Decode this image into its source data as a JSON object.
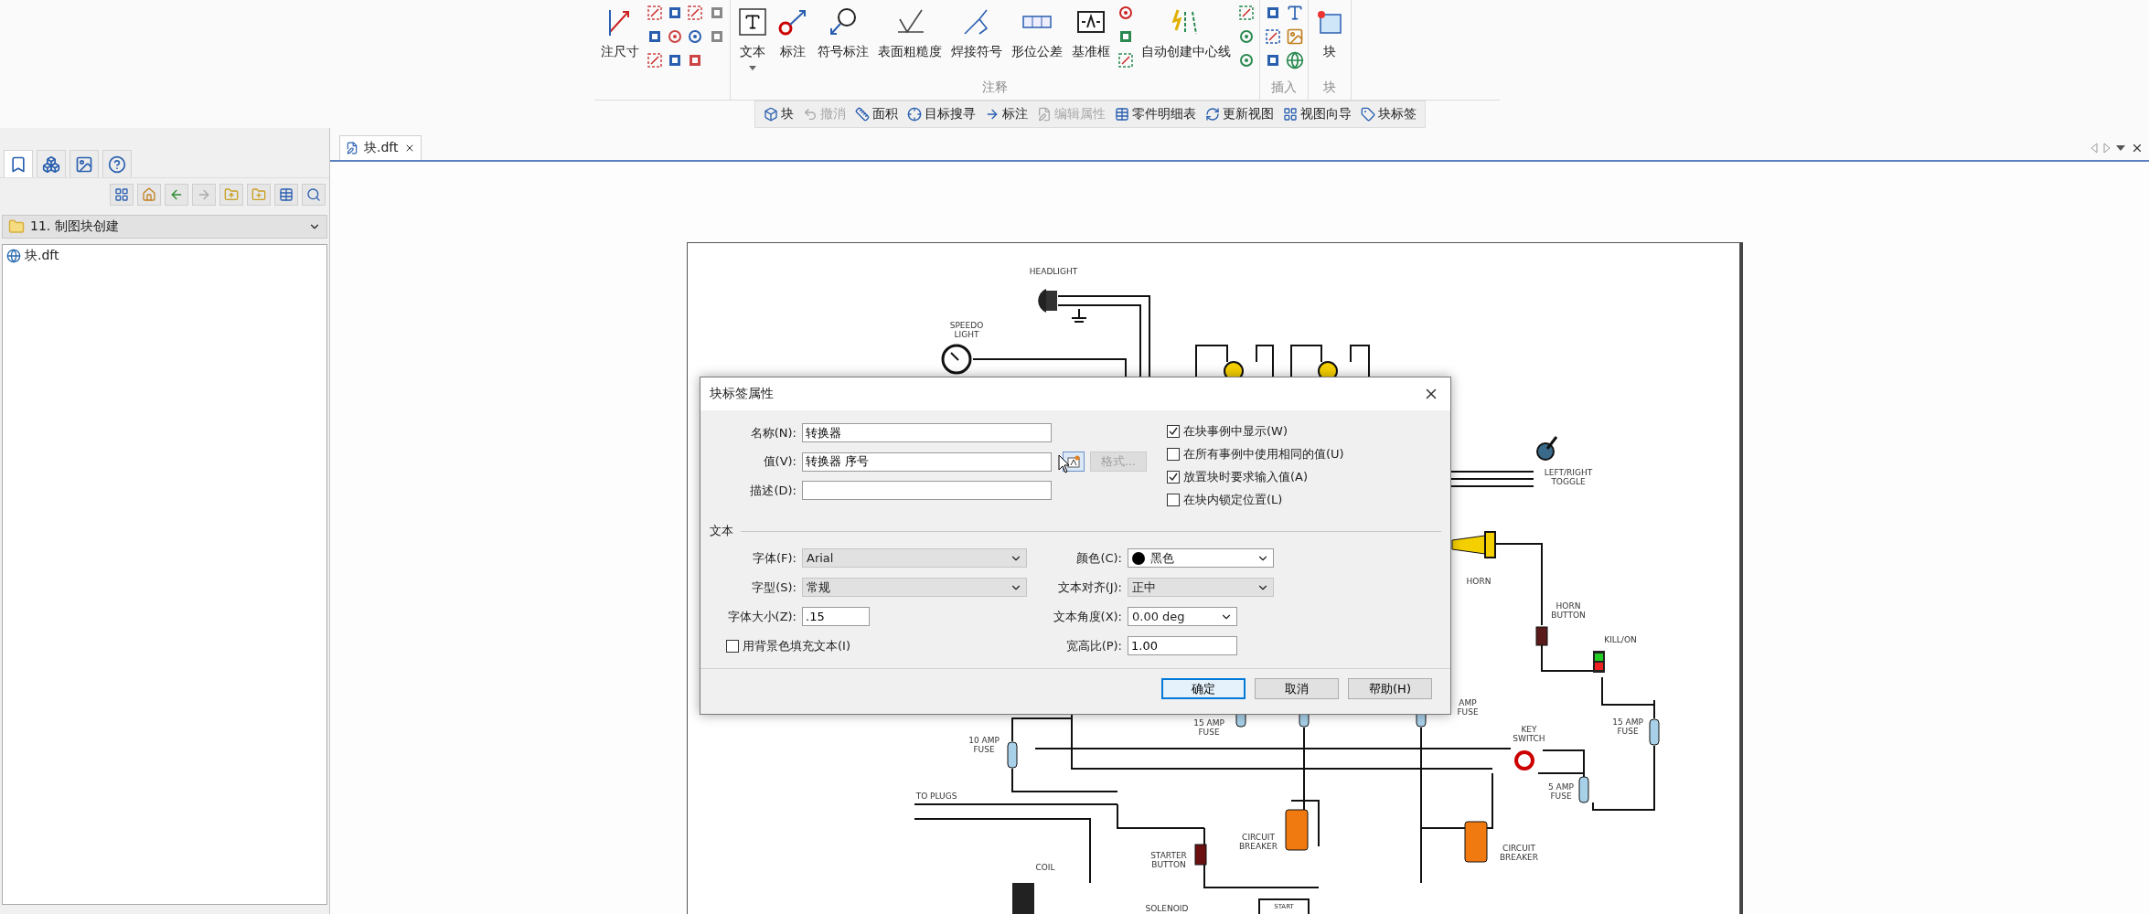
{
  "ribbon": {
    "partial_button": {
      "label": "注尺寸"
    },
    "annotation_group": {
      "label": "注释",
      "buttons": [
        {
          "label": "文本",
          "has_menu": true
        },
        {
          "label": "标注",
          "has_menu": false
        },
        {
          "label": "符号标注",
          "has_menu": false
        },
        {
          "label": "表面粗糙度",
          "has_menu": false
        },
        {
          "label": "焊接符号",
          "has_menu": false
        },
        {
          "label": "形位公差",
          "has_menu": false
        },
        {
          "label": "基准框",
          "has_menu": false
        },
        {
          "label": "自动创建中心线",
          "has_menu": false
        }
      ]
    },
    "insert_group": {
      "label": "插入"
    },
    "block_group": {
      "label": "块",
      "buttons": [
        {
          "label": "块"
        }
      ]
    }
  },
  "quick_bar": [
    {
      "label": "块",
      "disabled": false
    },
    {
      "label": "撤消",
      "disabled": true
    },
    {
      "label": "面积",
      "disabled": false
    },
    {
      "label": "目标搜寻",
      "disabled": false
    },
    {
      "label": "标注",
      "disabled": false
    },
    {
      "label": "编辑属性",
      "disabled": true
    },
    {
      "label": "零件明细表",
      "disabled": false
    },
    {
      "label": "更新视图",
      "disabled": false
    },
    {
      "label": "视图向导",
      "disabled": false
    },
    {
      "label": "块标签",
      "disabled": false
    }
  ],
  "left_panel": {
    "tabs": [
      {
        "selected": true
      },
      {
        "selected": false
      },
      {
        "selected": false
      },
      {
        "selected": false
      }
    ],
    "folder": "11. 制图块创建",
    "files": [
      "块.dft"
    ]
  },
  "document_tab": {
    "label": "块.dft"
  },
  "schematic": {
    "labels": [
      {
        "lines": [
          "HEADLIGHT"
        ]
      },
      {
        "lines": [
          "SPEEDO",
          "LIGHT"
        ]
      },
      {
        "lines": [
          "LEFT/RIGHT",
          "TOGGLE"
        ]
      },
      {
        "lines": [
          "HORN"
        ]
      },
      {
        "lines": [
          "HORN",
          "BUTTON"
        ]
      },
      {
        "lines": [
          "KILL/ON"
        ]
      },
      {
        "lines": [
          "AMP",
          "FUSE"
        ]
      },
      {
        "lines": [
          "10 AMP",
          "FUSE"
        ]
      },
      {
        "lines": [
          "15 AMP",
          "FUSE"
        ]
      },
      {
        "lines": [
          "KEY",
          "SWITCH"
        ]
      },
      {
        "lines": [
          "15 AMP",
          "FUSE"
        ]
      },
      {
        "lines": [
          "5 AMP",
          "FUSE"
        ]
      },
      {
        "lines": [
          "TO PLUGS"
        ]
      },
      {
        "lines": [
          "COIL"
        ]
      },
      {
        "lines": [
          "STARTER",
          "BUTTON"
        ]
      },
      {
        "lines": [
          "CIRCUIT",
          "BREAKER"
        ]
      },
      {
        "lines": [
          "CIRCUIT",
          "BREAKER"
        ]
      },
      {
        "lines": [
          "SOLENOID"
        ]
      },
      {
        "lines": [
          "START"
        ]
      }
    ]
  },
  "dialog": {
    "title": "块标签属性",
    "fields": [
      {
        "label": "名称(N):",
        "value": "转换器"
      },
      {
        "label": "值(V):",
        "value": "转换器 序号"
      },
      {
        "label": "描述(D):"
      }
    ],
    "format_button": {
      "label": "格式...",
      "disabled": true
    },
    "options": [
      {
        "label": "在块事例中显示(W)",
        "checked": true
      },
      {
        "label": "在所有事例中使用相同的值(U)",
        "checked": false
      },
      {
        "label": "放置块时要求输入值(A)",
        "checked": true
      },
      {
        "label": "在块内锁定位置(L)",
        "checked": false
      }
    ],
    "section": "文本",
    "text_settings_left": [
      {
        "label": "字体(F):",
        "value": "Arial",
        "kind": "select"
      },
      {
        "label": "字型(S):",
        "value": "常规",
        "kind": "select"
      },
      {
        "label": "字体大小(Z):",
        "value": ".15",
        "kind": "input"
      }
    ],
    "fill_option": {
      "label": "用背景色填充文本(I)",
      "checked": false
    },
    "text_settings_right": [
      {
        "label": "颜色(C):",
        "value": "黑色",
        "kind": "combo",
        "color": "#000000"
      },
      {
        "label": "文本对齐(J):",
        "value": "正中",
        "kind": "select"
      },
      {
        "label": "文本角度(X):",
        "value": "0.00 deg",
        "kind": "combo"
      },
      {
        "label": "宽高比(P):",
        "value": "1.00",
        "kind": "input"
      }
    ],
    "buttons": [
      {
        "label": "确定",
        "default": true
      },
      {
        "label": "取消",
        "default": false
      },
      {
        "label": "帮助(H)",
        "default": false
      }
    ]
  }
}
